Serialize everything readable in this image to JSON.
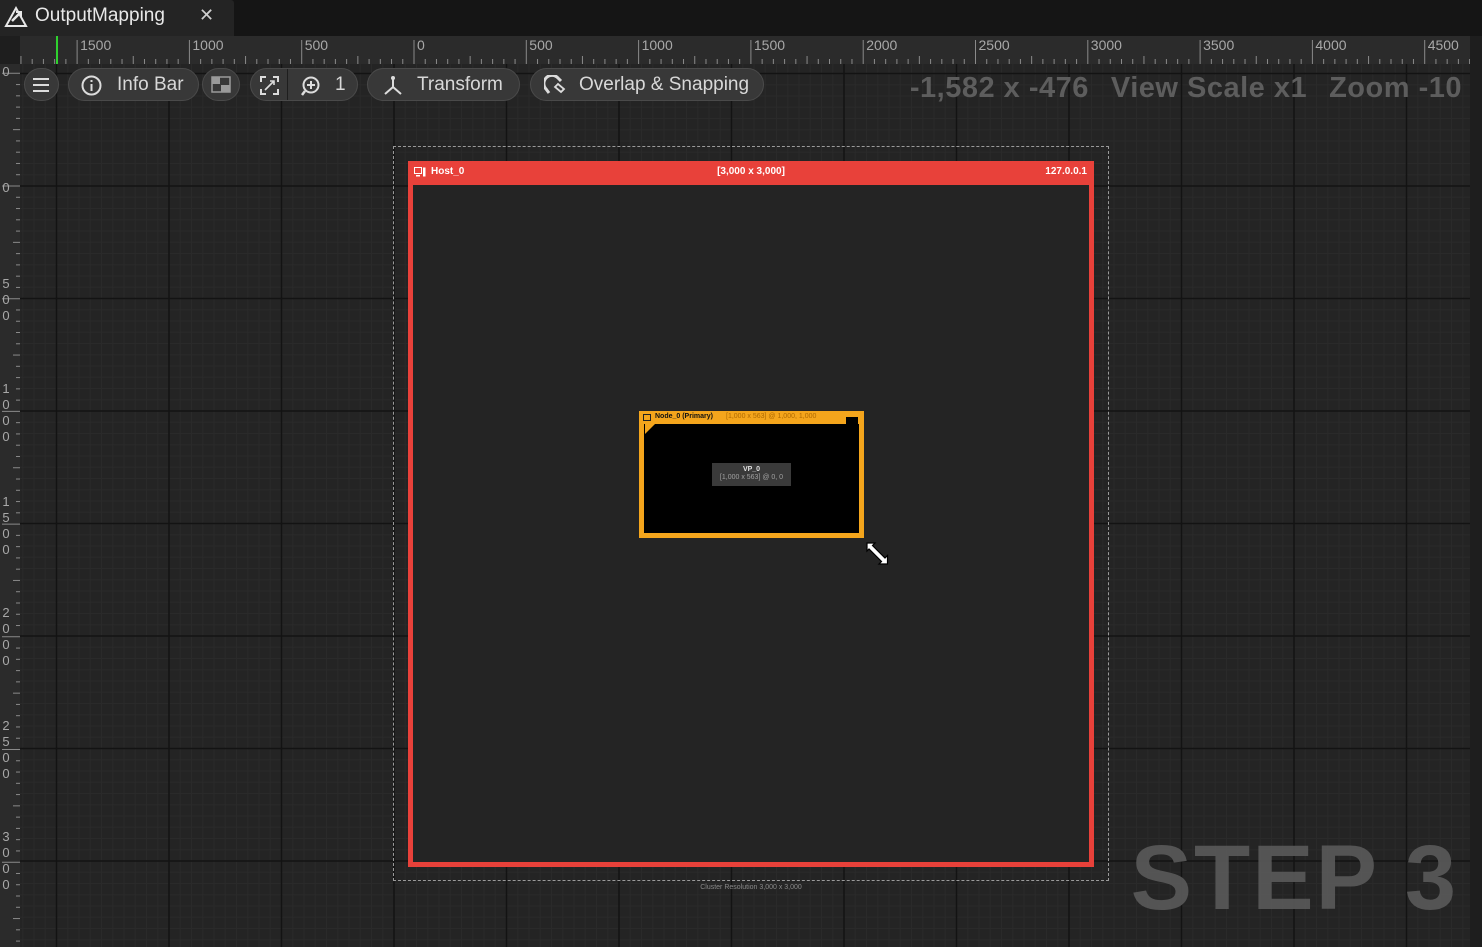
{
  "tab": {
    "title": "OutputMapping",
    "close_glyph": "✕",
    "icon": "unreal-logo-icon"
  },
  "ruler": {
    "horizontal_labels": [
      "1500",
      "1000",
      "500",
      "0",
      "500",
      "1000",
      "1500",
      "2000",
      "2500",
      "3000",
      "3500",
      "4000",
      "4500"
    ],
    "vertical_labels": [
      "0",
      "0",
      "5\n0\n0",
      "1\n0\n0\n0",
      "1\n5\n0\n0",
      "2\n0\n0\n0",
      "2\n5\n0\n0",
      "3\n0\n0\n0"
    ]
  },
  "toolbar": {
    "menu_icon": "hamburger-icon",
    "info_label": "Info Bar",
    "info_icon": "info-icon",
    "layout_icon": "layout-icon",
    "fit_icon": "fit-view-icon",
    "zoom_icon": "zoom-icon",
    "zoom_value": "1",
    "transform_label": "Transform",
    "transform_icon": "transform-gizmo-icon",
    "snapping_label": "Overlap & Snapping",
    "snapping_icon": "magnet-icon"
  },
  "status": {
    "coords": "-1,582 x -476",
    "view_scale": "View Scale x1",
    "zoom": "Zoom -10"
  },
  "cluster": {
    "resolution_label": "Cluster Resolution 3,000 x 3,000"
  },
  "host": {
    "name": "Host_0",
    "resolution": "[3,000 x 3,000]",
    "ip": "127.0.0.1",
    "color": "#e8413a"
  },
  "node": {
    "name": "Node_0 (Primary)",
    "geometry": "[1,000 x 563] @ 1,000, 1,000",
    "color": "#f4a51c"
  },
  "viewport": {
    "name": "VP_0",
    "geometry": "[1,000 x 563] @ 0, 0"
  },
  "watermark": {
    "text": "STEP 3"
  }
}
